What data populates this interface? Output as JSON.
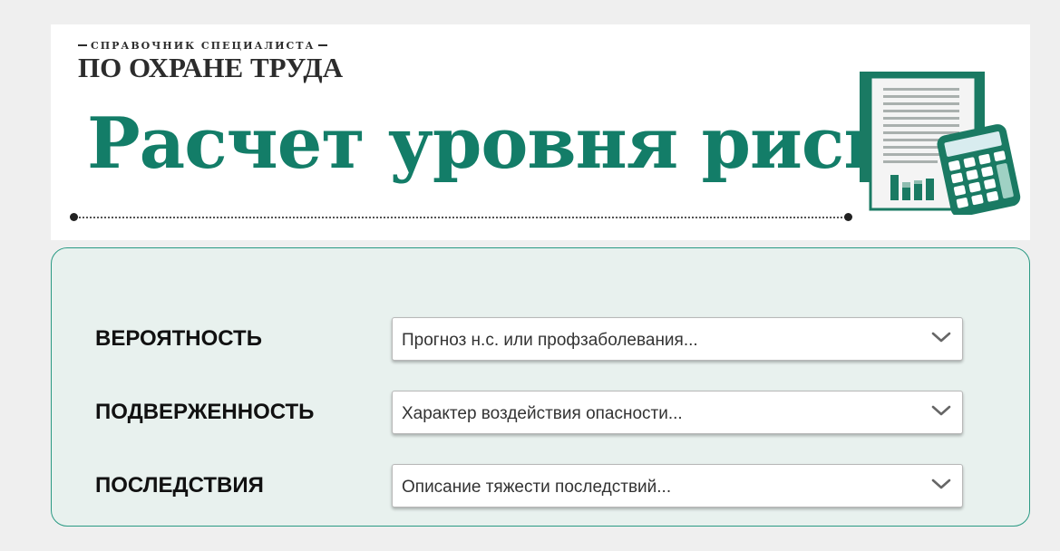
{
  "banner": {
    "overline": "СПРАВОЧНИК СПЕЦИАЛИСТА",
    "publication": "ПО ОХРАНЕ ТРУДА",
    "title": "Расчет уровня риска",
    "calculator_icon": "document-calculator-icon"
  },
  "form": {
    "rows": [
      {
        "label": "ВЕРОЯТНОСТЬ",
        "select_value": "Прогноз н.с. или профзаболевания..."
      },
      {
        "label": "ПОДВЕРЖЕННОСТЬ",
        "select_value": "Характер воздействия опасности..."
      },
      {
        "label": "ПОСЛЕДСТВИЯ",
        "select_value": "Описание тяжести последствий..."
      }
    ]
  },
  "colors": {
    "brand_green": "#137d68",
    "panel_bg": "#e8f1ee",
    "panel_border": "#2a9a84",
    "page_bg": "#efefef"
  }
}
